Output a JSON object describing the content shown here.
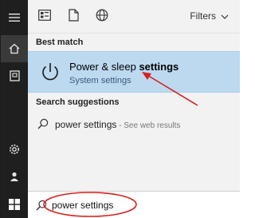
{
  "rail": {
    "items": [
      {
        "name": "menu-icon"
      },
      {
        "name": "home-icon"
      },
      {
        "name": "documents-icon"
      },
      {
        "name": "settings-icon"
      },
      {
        "name": "user-icon"
      },
      {
        "name": "windows-start-icon"
      }
    ]
  },
  "topbar": {
    "icons": [
      "app-grid-icon",
      "document-icon",
      "globe-icon"
    ],
    "filters_label": "Filters"
  },
  "best_match": {
    "section_label": "Best match",
    "title_prefix": "Power & sleep ",
    "title_bold": "settings",
    "subtitle": "System settings"
  },
  "suggestions": {
    "section_label": "Search suggestions",
    "items": [
      {
        "query": "power settings",
        "hint": " - See web results"
      }
    ]
  },
  "search": {
    "value": "power settings"
  },
  "colors": {
    "rail_bg": "#1f1f1f",
    "panel_bg": "#f2f2f2",
    "highlight_bg": "#bcd9f0",
    "annotation_red": "#d62020"
  }
}
